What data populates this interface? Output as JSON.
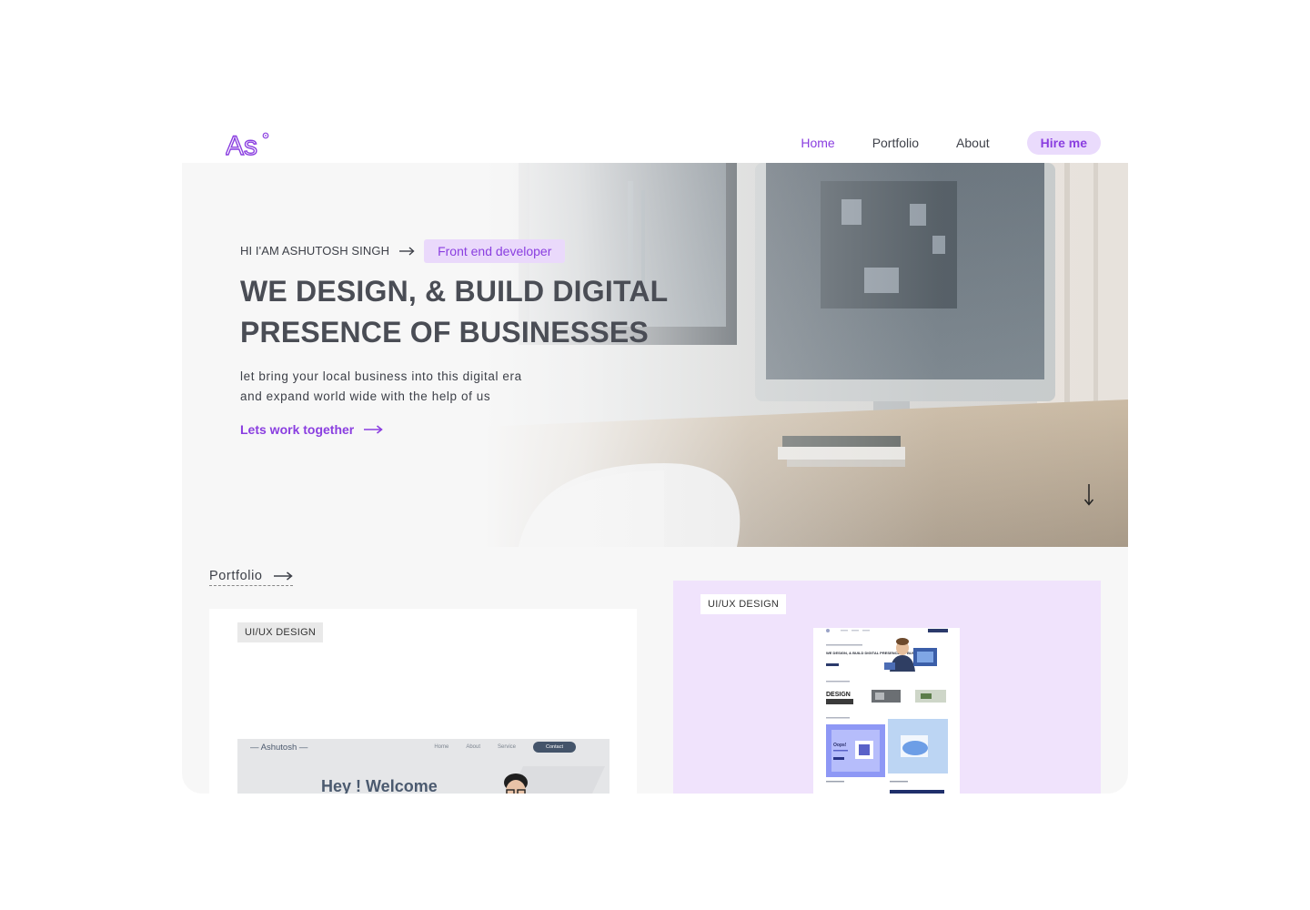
{
  "brand": {
    "logo_text": "As"
  },
  "nav": {
    "items": [
      "Home",
      "Portfolio",
      "About"
    ],
    "hire_label": "Hire me"
  },
  "hero": {
    "intro": "HI I'AM ASHUTOSH SINGH",
    "role_badge": "Front end developer",
    "headline_line1": "WE DESIGN, & BUILD DIGITAL",
    "headline_line2": "PRESENCE OF BUSINESSES",
    "subtext_line1": "let bring your local business into this digital era",
    "subtext_line2": "and expand world wide with the help of us",
    "cta_label": "Lets work together"
  },
  "portfolio": {
    "title": "Portfolio",
    "cards": [
      {
        "tag": "UI/UX DESIGN",
        "preview": {
          "brand": "— Ashutosh —",
          "nav": [
            "Home",
            "About",
            "Service"
          ],
          "contact": "Contact",
          "welcome": "Hey ! Welcome"
        }
      },
      {
        "tag": "UI/UX DESIGN",
        "preview": {
          "headline": "WE DESIGN, & BUILD DIGITAL PRESENCE OF BUSINESS",
          "design_word": "DESIGN",
          "oops": "Oops!"
        }
      }
    ]
  },
  "colors": {
    "accent": "#8a3ee0",
    "accent_soft": "#ead9fb",
    "text_dark": "#4a4d55",
    "card_purple": "#f0e3fc",
    "page_bg": "#f7f7f7"
  },
  "icons": [
    "logo-icon",
    "arrow-right-icon",
    "arrow-down-icon"
  ]
}
